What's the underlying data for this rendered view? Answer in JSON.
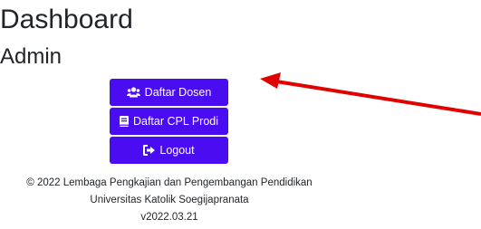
{
  "header": {
    "title": "Dashboard",
    "subtitle": "Admin"
  },
  "menu": {
    "daftar_dosen": {
      "label": "Daftar Dosen",
      "icon": "users-icon"
    },
    "daftar_cpl": {
      "label": "Daftar CPL Prodi",
      "icon": "book-icon"
    },
    "logout": {
      "label": "Logout",
      "icon": "sign-out-icon"
    }
  },
  "footer": {
    "line1": "© 2022 Lembaga Pengkajian dan Pengembangan Pendidikan",
    "line2": "Universitas Katolik Soegijapranata",
    "line3": "v2022.03.21"
  },
  "colors": {
    "button": "#4a0cf0",
    "annotation_arrow": "#e00000"
  }
}
